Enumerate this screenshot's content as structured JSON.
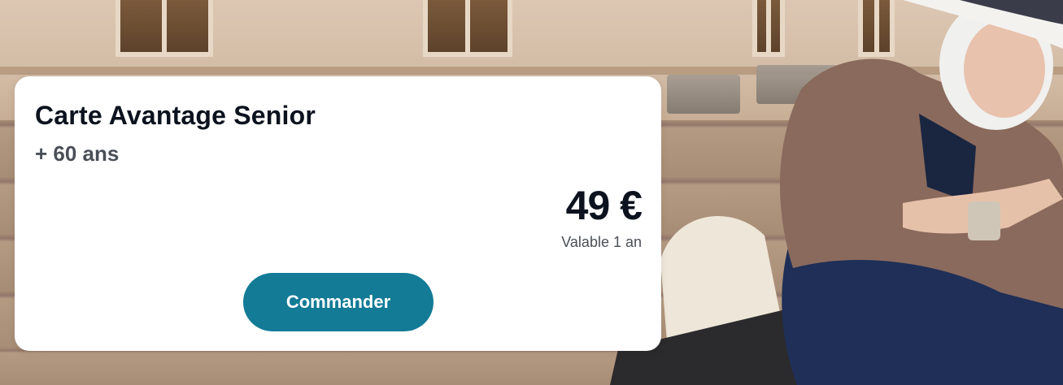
{
  "offer": {
    "title": "Carte Avantage Senior",
    "subtitle": "+ 60 ans",
    "price": "49 €",
    "validity": "Valable 1 an",
    "cta_label": "Commander"
  },
  "colors": {
    "card_background": "#ffffff",
    "title_text": "#0c131f",
    "secondary_text": "#4a4f57",
    "button_background": "#137b96",
    "button_text": "#ffffff"
  },
  "background_image": {
    "subject": "senior-woman-sitting-on-stone-steps"
  }
}
